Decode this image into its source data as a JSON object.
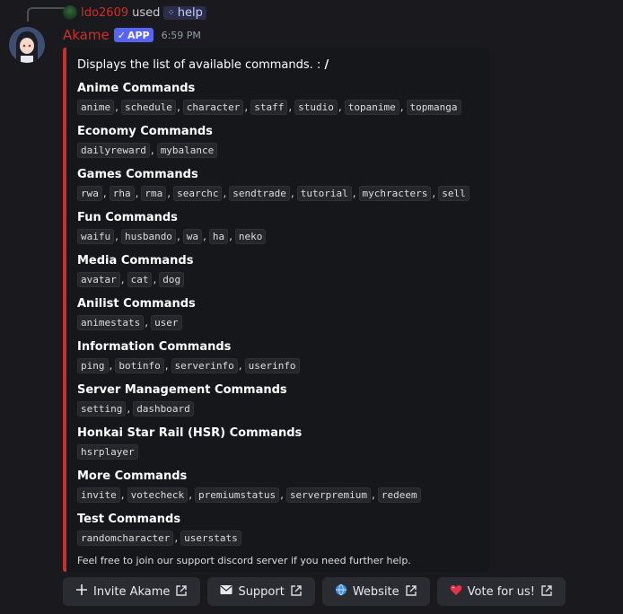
{
  "reply": {
    "username": "Ido2609",
    "used_text": "used",
    "command": "help"
  },
  "message": {
    "bot_name": "Akame",
    "badge": "APP",
    "timestamp": "6:59 PM"
  },
  "embed": {
    "description": "Displays the list of available commands. :",
    "description_bold": "/",
    "accent_color": "#c8312b",
    "fields": [
      {
        "name": "Anime Commands",
        "commands": [
          "anime",
          "schedule",
          "character",
          "staff",
          "studio",
          "topanime",
          "topmanga"
        ]
      },
      {
        "name": "Economy Commands",
        "commands": [
          "dailyreward",
          "mybalance"
        ]
      },
      {
        "name": "Games Commands",
        "commands": [
          "rwa",
          "rha",
          "rma",
          "searchc",
          "sendtrade",
          "tutorial",
          "mychracters",
          "sell"
        ]
      },
      {
        "name": "Fun Commands",
        "commands": [
          "waifu",
          "husbando",
          "wa",
          "ha",
          "neko"
        ]
      },
      {
        "name": "Media Commands",
        "commands": [
          "avatar",
          "cat",
          "dog"
        ]
      },
      {
        "name": "Anilist Commands",
        "commands": [
          "animestats",
          "user"
        ]
      },
      {
        "name": "Information Commands",
        "commands": [
          "ping",
          "botinfo",
          "serverinfo",
          "userinfo"
        ]
      },
      {
        "name": "Server Management Commands",
        "commands": [
          "setting",
          "dashboard"
        ]
      },
      {
        "name": "Honkai Star Rail (HSR) Commands",
        "commands": [
          "hsrplayer"
        ]
      },
      {
        "name": "More Commands",
        "commands": [
          "invite",
          "votecheck",
          "premiumstatus",
          "serverpremium",
          "redeem"
        ]
      },
      {
        "name": "Test Commands",
        "commands": [
          "randomcharacter",
          "userstats"
        ]
      }
    ],
    "footer": "Feel free to join our support discord server if you need further help."
  },
  "buttons": [
    {
      "label": "Invite Akame",
      "icon": "plus-icon"
    },
    {
      "label": "Support",
      "icon": "envelope-icon"
    },
    {
      "label": "Website",
      "icon": "globe-icon"
    },
    {
      "label": "Vote for us!",
      "icon": "heart-icon"
    }
  ]
}
